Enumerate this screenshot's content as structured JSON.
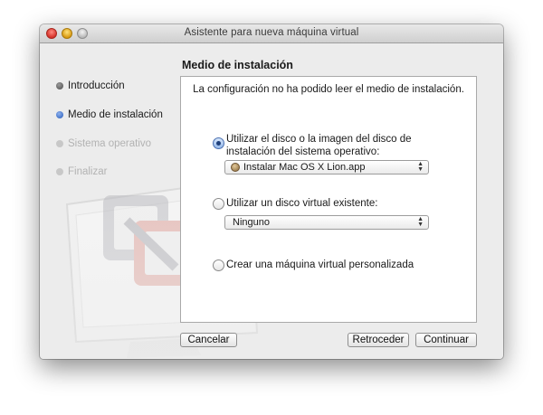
{
  "window": {
    "title": "Asistente para nueva máquina virtual"
  },
  "steps": [
    {
      "label": "Introducción",
      "state": "done"
    },
    {
      "label": "Medio de instalación",
      "state": "current"
    },
    {
      "label": "Sistema operativo",
      "state": "future"
    },
    {
      "label": "Finalizar",
      "state": "future"
    }
  ],
  "section_title": "Medio de instalación",
  "message": "La configuración no ha podido leer el medio de instalación.",
  "options": {
    "disk_image": {
      "label_line1": "Utilizar el disco o la imagen del disco de",
      "label_line2": "instalación del sistema operativo:",
      "selected": true,
      "popup_value": "Instalar Mac OS X Lion.app"
    },
    "existing_disk": {
      "label": "Utilizar un disco virtual existente:",
      "selected": false,
      "popup_value": "Ninguno"
    },
    "custom": {
      "label": "Crear una máquina virtual personalizada",
      "selected": false
    }
  },
  "buttons": {
    "cancel": "Cancelar",
    "back": "Retroceder",
    "continue": "Continuar"
  },
  "icons": {
    "popup_arrows": "updown-arrows-icon",
    "app": "mac-os-x-lion-icon"
  }
}
